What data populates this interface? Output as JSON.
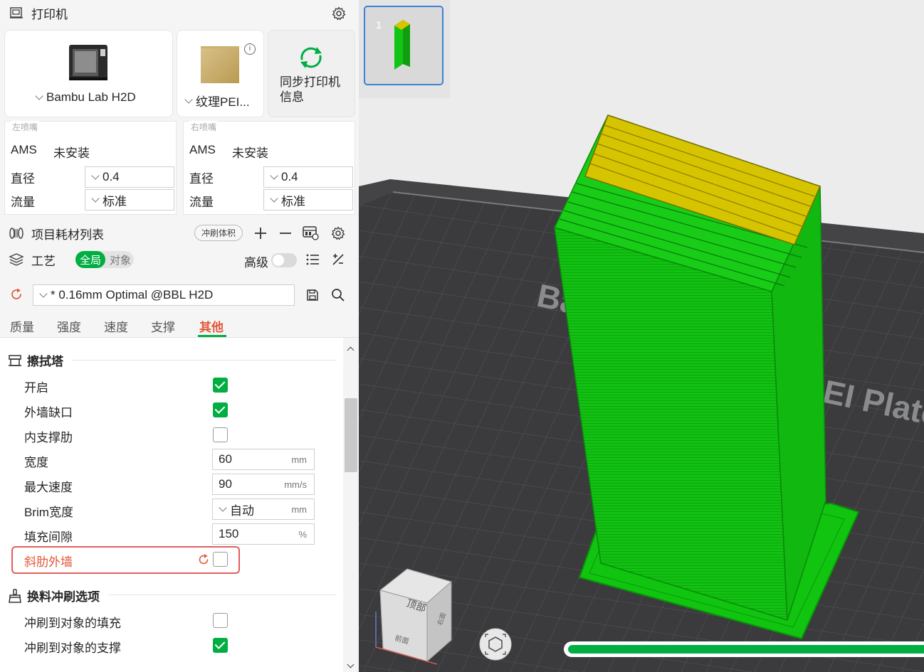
{
  "printer": {
    "section_title": "打印机",
    "printer_name": "Bambu Lab H2D",
    "plate_name": "纹理PEI...",
    "sync_label": "同步打印机信息",
    "sync_line1": "同步打印机",
    "sync_line2": "信息"
  },
  "left_nozzle": {
    "title": "左喷嘴",
    "ams_label": "AMS",
    "ams_value": "未安装",
    "diameter_label": "直径",
    "diameter_value": "0.4",
    "flow_label": "流量",
    "flow_value": "标准"
  },
  "right_nozzle": {
    "title": "右喷嘴",
    "ams_label": "AMS",
    "ams_value": "未安装",
    "diameter_label": "直径",
    "diameter_value": "0.4",
    "flow_label": "流量",
    "flow_value": "标准"
  },
  "filament": {
    "section_title": "项目耗材列表",
    "flush_volume_label": "冲刷体积"
  },
  "process": {
    "section_title": "工艺",
    "toggle_global": "全局",
    "toggle_object": "对象",
    "advanced_label": "高级",
    "preset_name": "* 0.16mm Optimal @BBL H2D"
  },
  "tabs": [
    {
      "label": "质量",
      "active": false
    },
    {
      "label": "强度",
      "active": false
    },
    {
      "label": "速度",
      "active": false
    },
    {
      "label": "支撑",
      "active": false
    },
    {
      "label": "其他",
      "active": true
    }
  ],
  "prime_tower": {
    "group_title": "擦拭塔",
    "enable": {
      "label": "开启",
      "checked": true
    },
    "skip_points": {
      "label": "外墙缺口",
      "checked": true
    },
    "internal_ribs": {
      "label": "内支撑肋",
      "checked": false
    },
    "width": {
      "label": "宽度",
      "value": "60",
      "unit": "mm"
    },
    "max_speed": {
      "label": "最大速度",
      "value": "90",
      "unit": "mm/s"
    },
    "brim_width": {
      "label": "Brim宽度",
      "value": "自动",
      "unit": "mm"
    },
    "infill_gap": {
      "label": "填充间隙",
      "value": "150",
      "unit": "%"
    },
    "rib_wall": {
      "label": "斜肋外墙",
      "checked": false
    }
  },
  "flush": {
    "group_title": "换料冲刷选项",
    "into_infill": {
      "label": "冲刷到对象的填充",
      "checked": false
    },
    "into_support": {
      "label": "冲刷到对象的支撑",
      "checked": true
    }
  },
  "viewport": {
    "plate_number": "1",
    "cube_top": "顶部",
    "cube_front": "前面",
    "cube_right": "右面",
    "bed_text_1": "Ba",
    "bed_text_2": "EI Plate",
    "progress_fraction": 1.0
  },
  "colors": {
    "accent": "#00ae42",
    "highlight": "#e2573a",
    "tower_green": "#14c414",
    "tower_yellow": "#d9c200"
  }
}
